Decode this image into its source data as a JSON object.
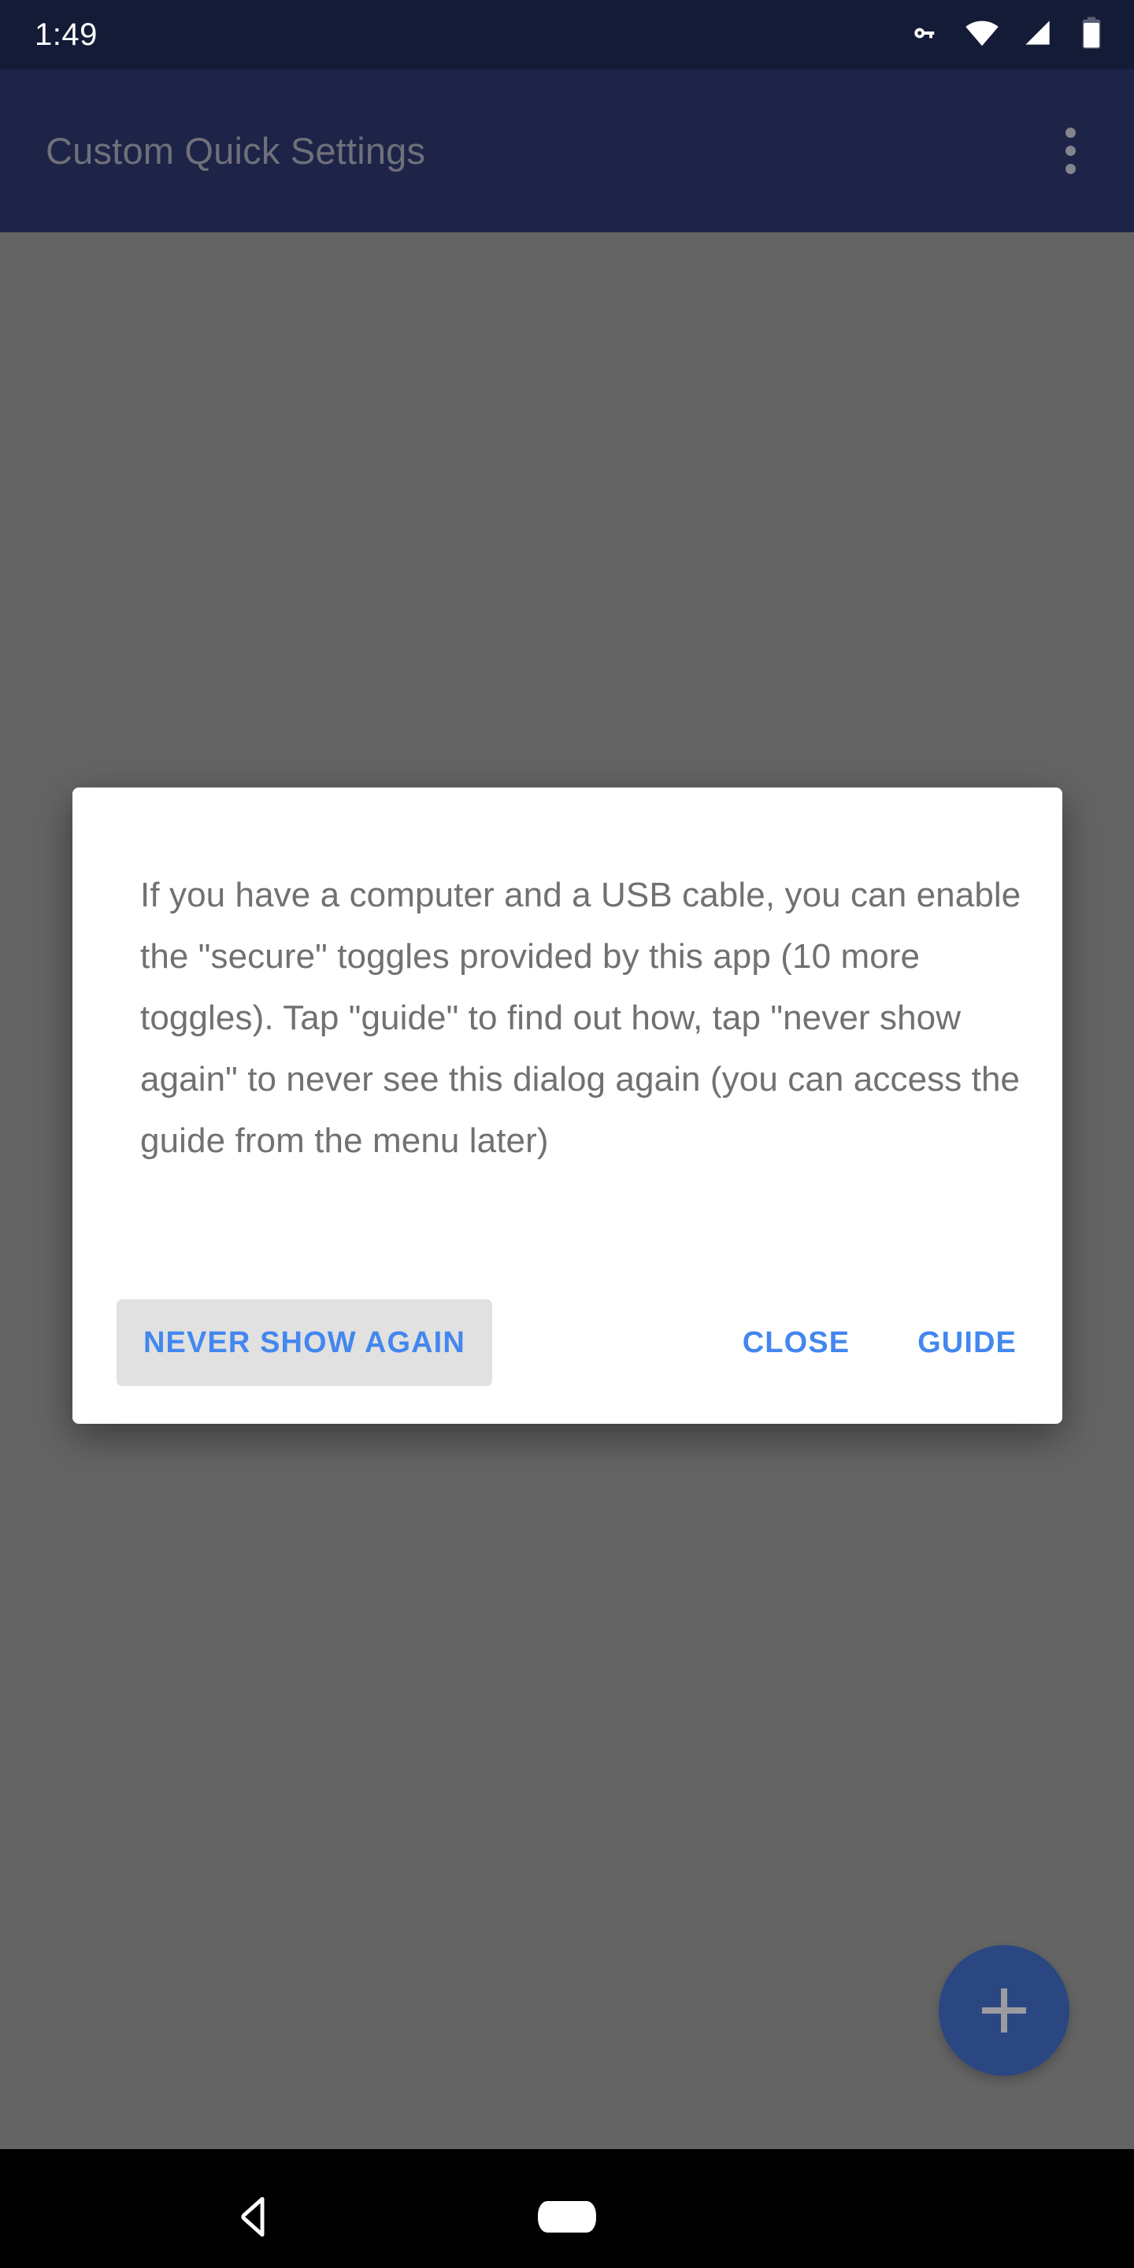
{
  "status_bar": {
    "clock": "1:49",
    "icons": [
      {
        "name": "vpn-key-icon",
        "label": "VPN key"
      },
      {
        "name": "wifi-icon",
        "label": "Wi-Fi"
      },
      {
        "name": "cellular-signal-icon",
        "label": "Cellular signal"
      },
      {
        "name": "battery-icon",
        "label": "Battery"
      }
    ],
    "background_color": "#141b36",
    "foreground_color": "#ffffff"
  },
  "app_bar": {
    "title": "Custom Quick Settings",
    "overflow_menu_label": "More options",
    "background_color": "#1d2448",
    "title_color": "#6f7079"
  },
  "content": {
    "scrim_color": "#646464",
    "fab": {
      "label": "+",
      "icon": "plus-icon",
      "background_color": "#2a4782"
    }
  },
  "dialog": {
    "message": "If you have a computer and a USB cable, you can enable the \"secure\" toggles provided by this app (10 more toggles). Tap \"guide\" to find out how, tap \"never show again\" to never see this dialog again (you can access the guide from the menu later)",
    "message_color": "#717171",
    "background_color": "#ffffff",
    "buttons": {
      "never_show_again": "NEVER SHOW AGAIN",
      "close": "CLOSE",
      "guide": "GUIDE"
    },
    "button_color": "#4387ef",
    "pressed_button_background": "#e1e1e1"
  },
  "nav_bar": {
    "background_color": "#000000",
    "back_label": "Back",
    "home_label": "Home"
  }
}
